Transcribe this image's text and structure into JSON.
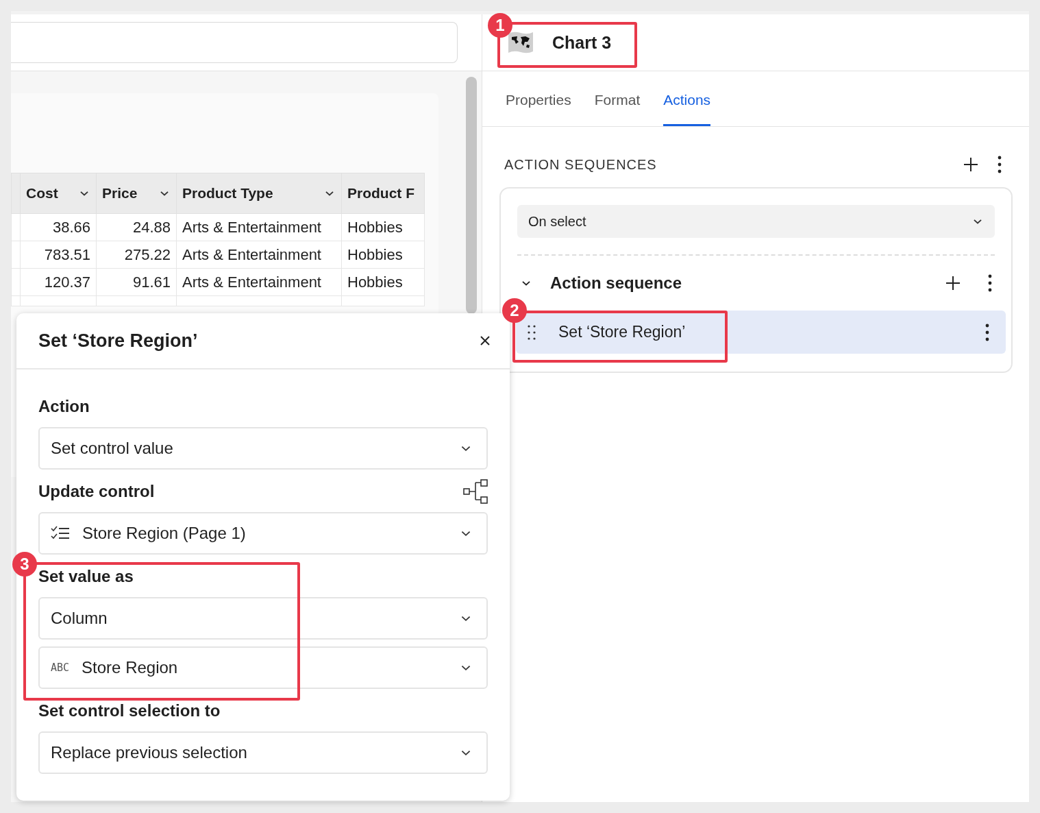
{
  "table": {
    "columns": [
      {
        "label": "Cost",
        "has_menu": true
      },
      {
        "label": "Price",
        "has_menu": true
      },
      {
        "label": "Product Type",
        "has_menu": true
      },
      {
        "label": "Product F",
        "has_menu": false
      }
    ],
    "rows": [
      [
        "38.66",
        "24.88",
        "Arts & Entertainment",
        "Hobbies"
      ],
      [
        "783.51",
        "275.22",
        "Arts & Entertainment",
        "Hobbies"
      ],
      [
        "120.37",
        "91.61",
        "Arts & Entertainment",
        "Hobbies"
      ]
    ]
  },
  "panel": {
    "title": "Chart 3",
    "tabs": [
      {
        "label": "Properties",
        "selected": false
      },
      {
        "label": "Format",
        "selected": false
      },
      {
        "label": "Actions",
        "selected": true
      }
    ],
    "section_title": "ACTION SEQUENCES",
    "trigger": "On select",
    "sequence": {
      "title": "Action sequence",
      "expanded": true,
      "actions": [
        {
          "label": "Set ‘Store Region’",
          "selected": true
        }
      ]
    }
  },
  "dialog": {
    "title": "Set ‘Store Region’",
    "sections": [
      {
        "label": "Action",
        "kind": "plain",
        "selects": [
          {
            "value": "Set control value",
            "kind": "plain"
          }
        ]
      },
      {
        "label": "Update control",
        "kind": "control",
        "selects": [
          {
            "value": "Store Region (Page 1)",
            "kind": "control"
          }
        ]
      },
      {
        "label": "Set value as",
        "kind": "plain",
        "selects": [
          {
            "value": "Column",
            "kind": "plain"
          },
          {
            "value": "Store Region",
            "kind": "column",
            "type_badge": "ABC"
          }
        ]
      },
      {
        "label": "Set control selection to",
        "kind": "plain",
        "selects": [
          {
            "value": "Replace previous selection",
            "kind": "plain"
          }
        ]
      }
    ]
  },
  "annotations": [
    {
      "number": "1"
    },
    {
      "number": "2"
    },
    {
      "number": "3"
    }
  ]
}
